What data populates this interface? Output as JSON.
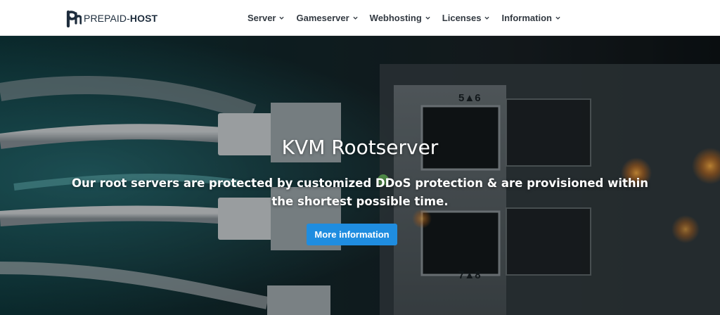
{
  "brand": {
    "logo_light": "PREPAID-",
    "logo_bold": "HOST",
    "colors": {
      "text_dark": "#1e2d3d",
      "accent": "#1f8de0"
    }
  },
  "nav": {
    "items": [
      {
        "label": "Server"
      },
      {
        "label": "Gameserver"
      },
      {
        "label": "Webhosting"
      },
      {
        "label": "Licenses"
      },
      {
        "label": "Information"
      }
    ]
  },
  "hero": {
    "title": "KVM Rootserver",
    "subtitle": "Our root servers are protected by customized DDoS protection & are provisioned within the shortest possible time.",
    "button_label": "More information",
    "port_labels": [
      "5▲6",
      "7▲8"
    ]
  }
}
